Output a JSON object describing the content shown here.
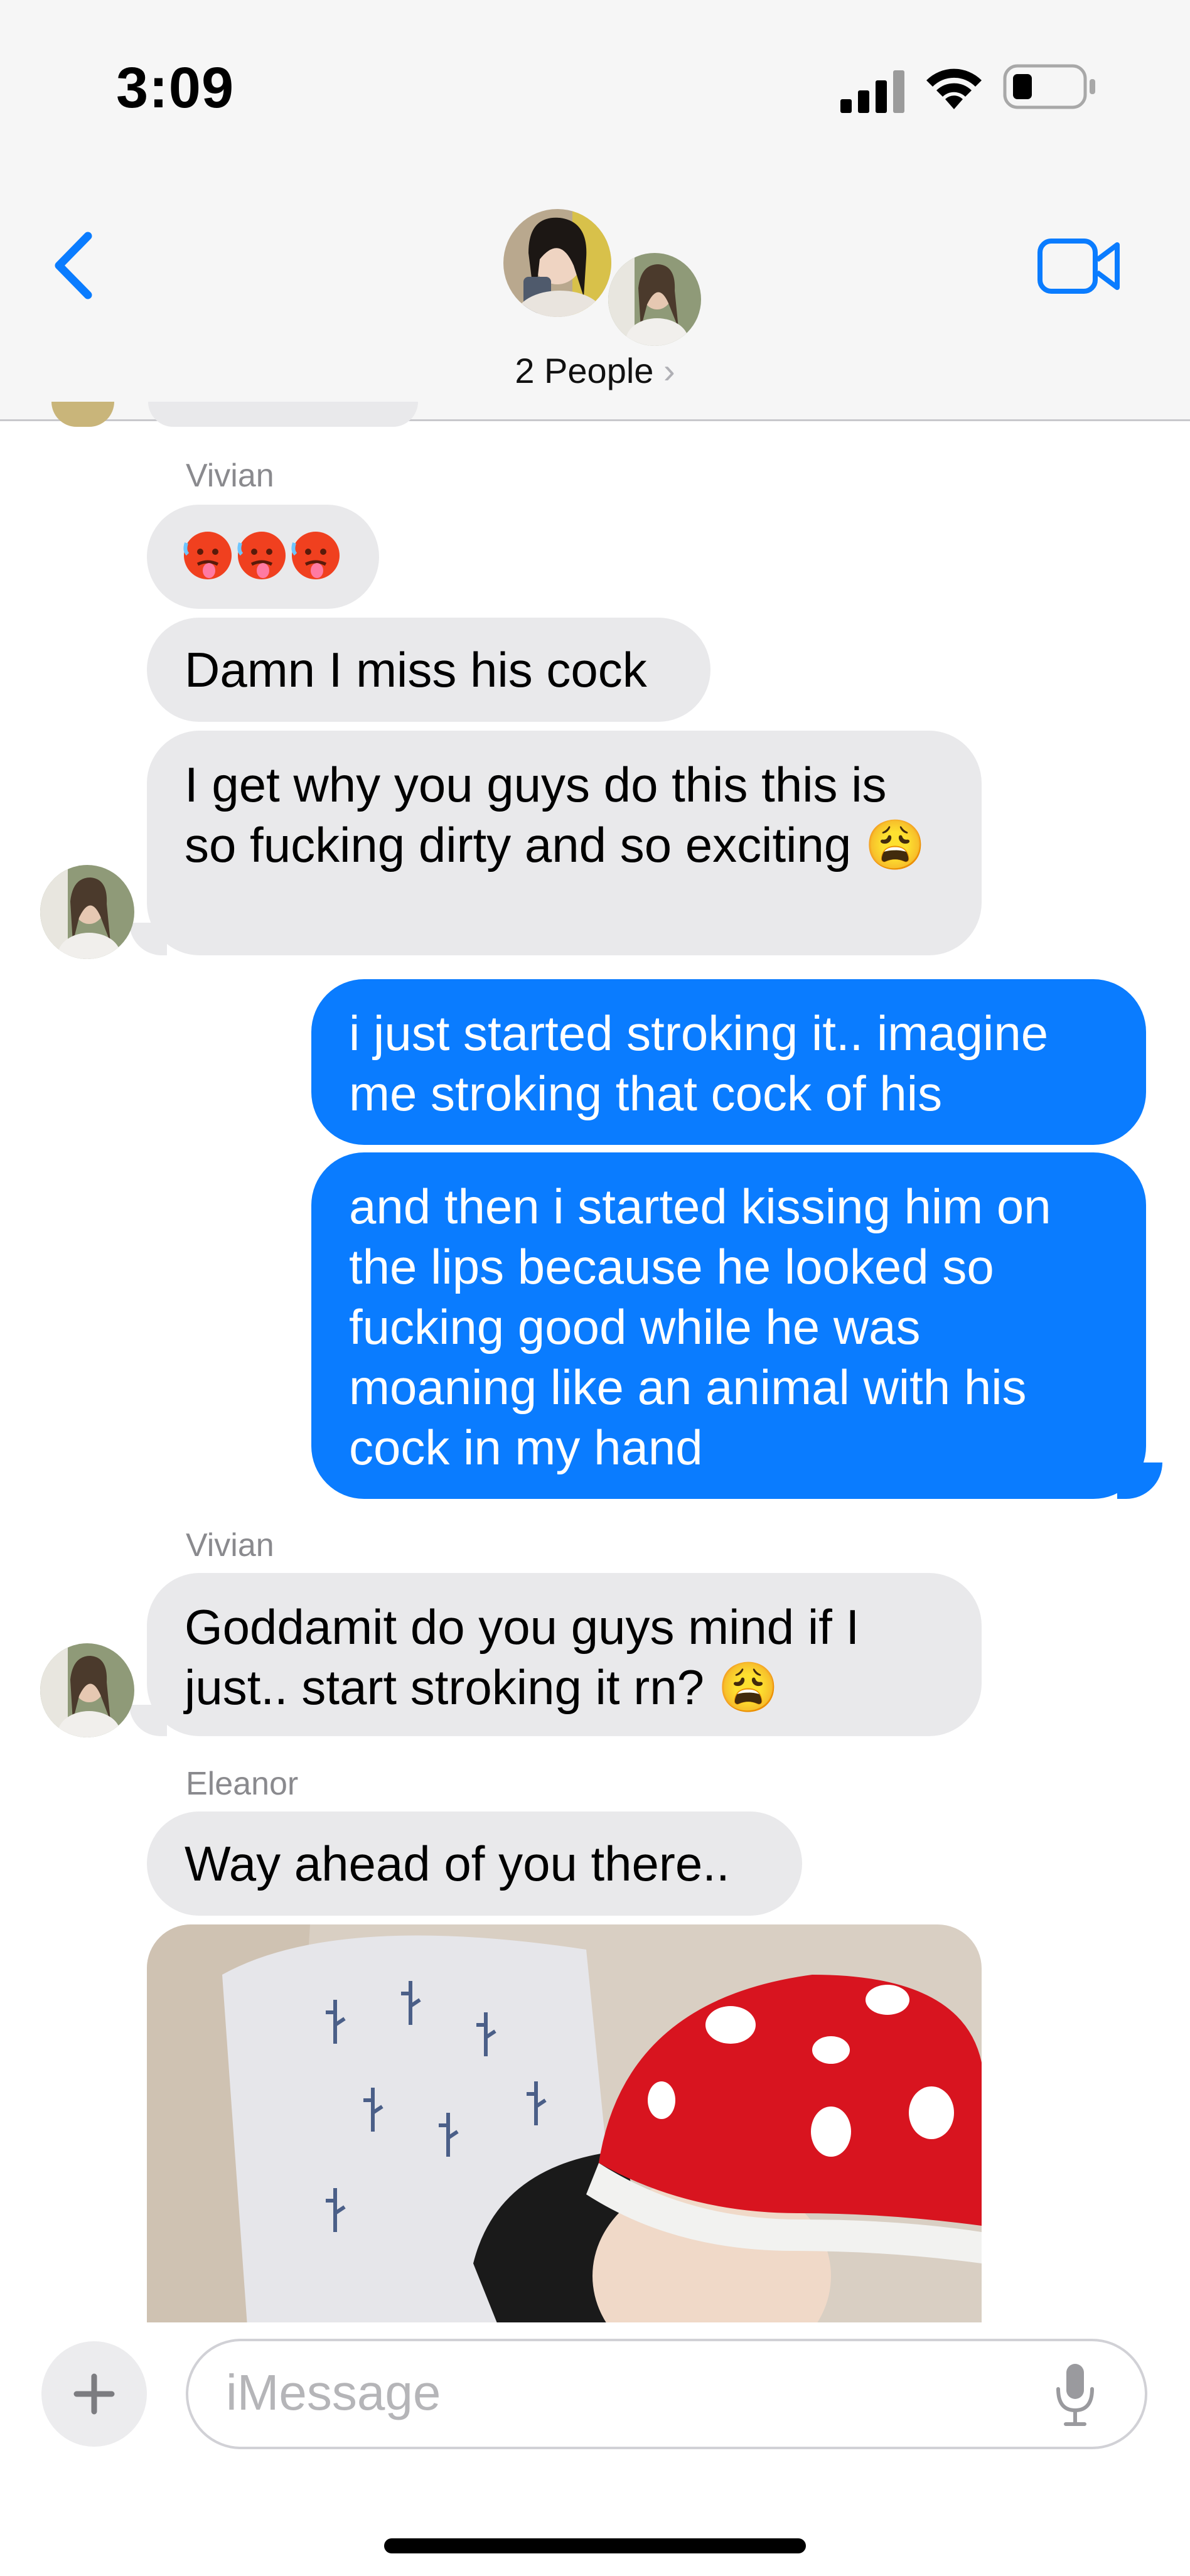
{
  "status_bar": {
    "time": "3:09"
  },
  "header": {
    "group_name": "2 People",
    "chevron": "›"
  },
  "messages": [
    {
      "sender": "Vivian",
      "emoji": "🥵🥵🥵",
      "text": "Damn I miss his cock",
      "text_last": "I get why you guys do this this is so fucking dirty and so exciting 😩"
    },
    {
      "out1": "i just started stroking it.. imagine me stroking that cock of his",
      "out2": "and then i started kissing him on the lips because he looked so fucking good while he was moaning like an animal with his cock in my hand"
    },
    {
      "sender": "Vivian",
      "text": "Goddamit do you guys mind if I just.. start stroking it rn? 😩"
    },
    {
      "sender": "Eleanor",
      "text": "Way ahead of you there.."
    }
  ],
  "composer": {
    "placeholder": "iMessage",
    "plus": "+"
  },
  "icons": [
    "back-chevron-icon",
    "video-call-icon",
    "signal-icon",
    "wifi-icon",
    "battery-icon",
    "plus-icon",
    "microphone-icon",
    "weary-face-emoji",
    "hot-face-emoji"
  ],
  "colors": {
    "outgoing": "#0a7cff",
    "incoming": "#e9e9eb",
    "accent": "#0a7cff"
  }
}
